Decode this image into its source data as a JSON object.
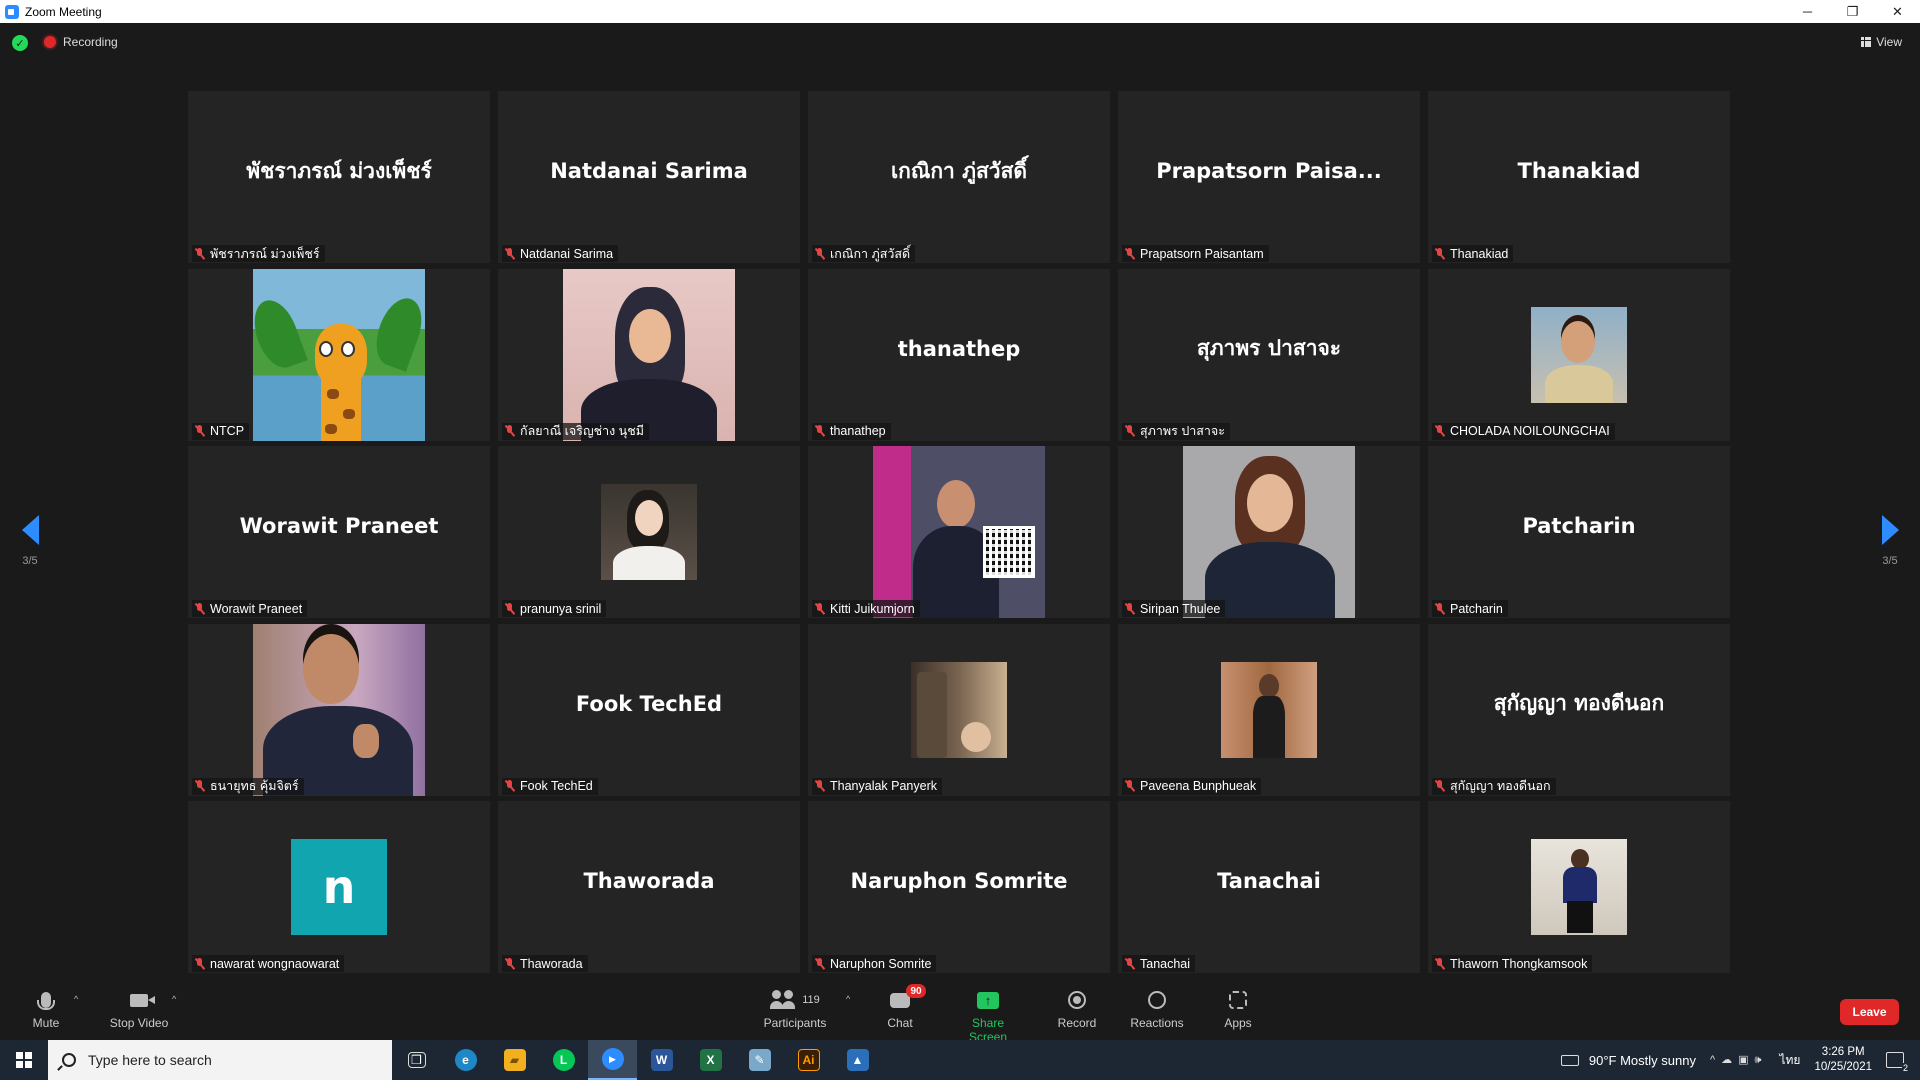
{
  "window": {
    "title": "Zoom Meeting"
  },
  "window_controls": {
    "minimize": "─",
    "restore": "❐",
    "close": "✕"
  },
  "topbar": {
    "recording_label": "Recording",
    "view_label": "View",
    "shield_glyph": "✓",
    "colors": {
      "recording": "#e02828",
      "shield": "#23d959"
    }
  },
  "pagination": {
    "left": "3/5",
    "right": "3/5"
  },
  "tiles": [
    {
      "name": "พัชราภรณ์ ม่วงเพ็ชร์",
      "big": "พัชราภรณ์ ม่วงเพ็ชร์",
      "media": "name"
    },
    {
      "name": "Natdanai Sarima",
      "big": "Natdanai Sarima",
      "media": "name"
    },
    {
      "name": "เกณิกา ภู่สวัสดิ์",
      "big": "เกณิกา ภู่สวัสดิ์",
      "media": "name"
    },
    {
      "name": "Prapatsorn Paisantam",
      "big": "Prapatsorn Paisa...",
      "media": "name"
    },
    {
      "name": "Thanakiad",
      "big": "Thanakiad",
      "media": "name"
    },
    {
      "name": "NTCP",
      "media": "giraffe-picture"
    },
    {
      "name": "กัลยาณี เจริญช่าง นุชมี",
      "media": "hijab-portrait"
    },
    {
      "name": "thanathep",
      "big": "thanathep",
      "media": "name"
    },
    {
      "name": "สุภาพร ปาสาจะ",
      "big": "สุภาพร ปาสาจะ",
      "media": "name"
    },
    {
      "name": "CHOLADA NOILOUNGCHAI",
      "media": "small-portrait"
    },
    {
      "name": "Worawit Praneet",
      "big": "Worawit Praneet",
      "media": "name"
    },
    {
      "name": "pranunya srinil",
      "media": "small-portrait"
    },
    {
      "name": "Kitti Juikumjorn",
      "media": "poster"
    },
    {
      "name": "Siripan Thulee",
      "media": "suit-portrait"
    },
    {
      "name": "Patcharin",
      "big": "Patcharin",
      "media": "name"
    },
    {
      "name": "ธนายุทธ คุ้มจิตร์",
      "media": "thumbs-up-photo"
    },
    {
      "name": "Fook TechEd",
      "big": "Fook TechEd",
      "media": "name"
    },
    {
      "name": "Thanyalak Panyerk",
      "media": "small-photo"
    },
    {
      "name": "Paveena Bunphueak",
      "media": "small-photo"
    },
    {
      "name": "สุกัญญา ทองดีนอก",
      "big": "สุกัญญา ทองดีนอก",
      "media": "name"
    },
    {
      "name": "nawarat wongnaowarat",
      "media": "letter-avatar",
      "avatar_letter": "n"
    },
    {
      "name": "Thaworada",
      "big": "Thaworada",
      "media": "name"
    },
    {
      "name": "Naruphon Somrite",
      "big": "Naruphon Somrite",
      "media": "name"
    },
    {
      "name": "Tanachai",
      "big": "Tanachai",
      "media": "name"
    },
    {
      "name": "Thaworn Thongkamsook",
      "media": "small-photo"
    }
  ],
  "toolbar": {
    "mute": "Mute",
    "stop_video": "Stop Video",
    "participants": "Participants",
    "participants_count": "119",
    "chat": "Chat",
    "chat_badge": "90",
    "share_screen": "Share Screen",
    "share_glyph": "↑",
    "record": "Record",
    "reactions": "Reactions",
    "apps": "Apps",
    "leave": "Leave",
    "caret": "^",
    "colors": {
      "share": "#22c55e",
      "leave": "#e02828"
    }
  },
  "taskbar": {
    "search_placeholder": "Type here to search",
    "apps": [
      {
        "icon": "task-view-icon",
        "glyph": "❒",
        "color": "#1c2733"
      },
      {
        "icon": "edge-icon",
        "glyph": "e",
        "color": "#1e88c7"
      },
      {
        "icon": "file-explorer-icon",
        "glyph": "▰",
        "color": "#f2b01e"
      },
      {
        "icon": "line-icon",
        "glyph": "L",
        "color": "#06c755"
      },
      {
        "icon": "zoom-icon",
        "glyph": "▶",
        "color": "#2d8cff"
      },
      {
        "icon": "word-icon",
        "glyph": "W",
        "color": "#2b579a"
      },
      {
        "icon": "excel-icon",
        "glyph": "X",
        "color": "#217346"
      },
      {
        "icon": "notepad-icon",
        "glyph": "✎",
        "color": "#7aa8c8"
      },
      {
        "icon": "illustrator-icon",
        "glyph": "Ai",
        "color": "#3b1e06"
      },
      {
        "icon": "photos-icon",
        "glyph": "▲",
        "color": "#2a6fb8"
      }
    ],
    "weather": "90°F  Mostly sunny",
    "tray_glyphs": "^☁▣🕪",
    "language": "ไทย",
    "time": "3:26 PM",
    "date": "10/25/2021",
    "notification_count": "2"
  }
}
